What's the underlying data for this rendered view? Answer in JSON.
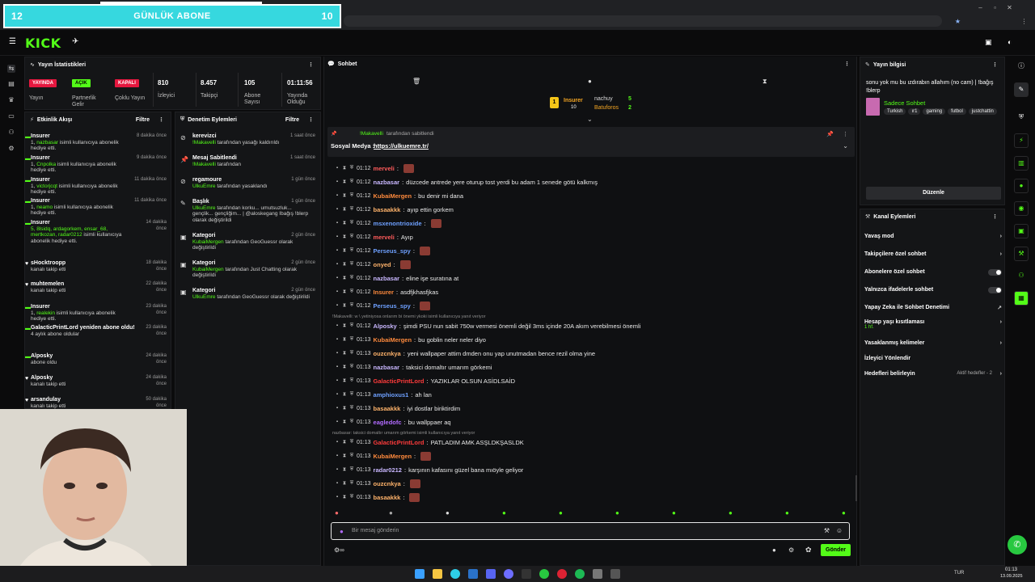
{
  "overlay": {
    "left_num": "12",
    "title": "GÜNLÜK ABONE",
    "right_num": "10"
  },
  "brand": {
    "logo": "KICK"
  },
  "stats": {
    "title": "Yayın İstatistikleri",
    "badges": [
      {
        "label": "YAYINDA",
        "color": "#e5173f",
        "caption": "Yayın"
      },
      {
        "label": "AÇIK",
        "color": "#53fc18",
        "caption": "Partnerlik Gelir"
      },
      {
        "label": "KAPALI",
        "color": "#e5173f",
        "caption": "Çoklu Yayın"
      }
    ],
    "numbers": [
      {
        "value": "810",
        "label": "İzleyici"
      },
      {
        "value": "8.457",
        "label": "Takipçi"
      },
      {
        "value": "105",
        "label": "Abone Sayısı"
      },
      {
        "value": "01:11:56",
        "label": "Yayında Olduğu"
      }
    ]
  },
  "activity": {
    "title": "Etkinlik Akışı",
    "filter": "Filtre",
    "items": [
      {
        "name": "Insurer",
        "desc_pre": "1, ",
        "desc_hl": "nazbasar",
        "desc_post": " isimli kullanıcıya abonelik hediye etti.",
        "time": "8 dakika önce"
      },
      {
        "name": "Insurer",
        "desc_pre": "1, ",
        "desc_hl": "Cnpolka",
        "desc_post": " isimli kullanıcıya abonelik hediye etti.",
        "time": "9 dakika önce"
      },
      {
        "name": "Insurer",
        "desc_pre": "1, ",
        "desc_hl": "victorjcqt",
        "desc_post": " isimli kullanıcıya abonelik hediye etti.",
        "time": "11 dakika önce"
      },
      {
        "name": "Insurer",
        "desc_pre": "1, ",
        "desc_hl": "neamo",
        "desc_post": " isimli kullanıcıya abonelik hediye etti.",
        "time": "11 dakika önce"
      },
      {
        "name": "Insurer",
        "desc_pre": "",
        "desc_hl": "5, 8lsidq, ardagorkem, ensar_68, mertkozan, radar0212",
        "desc_post": " isimli kullanıcıya abonelik hediye etti.",
        "time": "14 dakika önce"
      },
      {
        "name": "sHocktroopp",
        "desc_pre": "kanalı takip etti",
        "desc_hl": "",
        "desc_post": "",
        "time": "18 dakika önce"
      },
      {
        "name": "muhtemelen",
        "desc_pre": "kanalı takip etti",
        "desc_hl": "",
        "desc_post": "",
        "time": "22 dakika önce"
      },
      {
        "name": "Insurer",
        "desc_pre": "1, ",
        "desc_hl": "realekin",
        "desc_post": " isimli kullanıcıya abonelik hediye etti.",
        "time": "23 dakika önce"
      },
      {
        "name": "GalacticPrintLord yeniden abone oldu!",
        "desc_pre": "4 aylık abone oldular",
        "desc_hl": "",
        "desc_post": "",
        "time": "23 dakika önce"
      },
      {
        "name": "Alposky",
        "desc_pre": "abone oldu",
        "desc_hl": "",
        "desc_post": "",
        "time": "24 dakika önce"
      },
      {
        "name": "Alposky",
        "desc_pre": "kanalı takip etti",
        "desc_hl": "",
        "desc_post": "",
        "time": "24 dakika önce"
      },
      {
        "name": "arsandulay",
        "desc_pre": "kanalı takip etti",
        "desc_hl": "",
        "desc_post": "",
        "time": "50 dakika önce"
      }
    ]
  },
  "moderation": {
    "title": "Denetim Eylemleri",
    "filter": "Filtre",
    "items": [
      {
        "name": "kerevizci",
        "hl": "!Makavelli",
        "post": " tarafından yasağı kaldırıldı",
        "time": "1 saat önce"
      },
      {
        "name": "Mesaj Sabitlendi",
        "hl": "!Makavelli",
        "post": " tarafından",
        "time": "1 saat önce"
      },
      {
        "name": "regamoure",
        "hl": "UlkuEmre",
        "post": " tarafından yasaklandı",
        "time": "1 gün önce"
      },
      {
        "name": "Başlık",
        "hl": "UlkuEmre",
        "post": " tarafından korku... umutsuzluk... gençlik... gençliğim... | @aloskegang Ibağış !blerp olarak değiştirildi",
        "time": "1 gün önce"
      },
      {
        "name": "Kategori",
        "hl": "KubaiMergen",
        "post": " tarafından GeoGuessr olarak değiştirildi",
        "time": "2 gün önce"
      },
      {
        "name": "Kategori",
        "hl": "KubaiMergen",
        "post": " tarafından Just Chatting olarak değiştirildi",
        "time": "2 gün önce"
      },
      {
        "name": "Kategori",
        "hl": "UlkuEmre",
        "post": " tarafından GeoGuessr olarak değiştirildi",
        "time": "2 gün önce"
      }
    ]
  },
  "chat": {
    "title": "Sohbet",
    "leaders": [
      {
        "rank": "1",
        "name": "Insurer",
        "count": "10",
        "color": "#f5a623"
      },
      {
        "rank": "",
        "name": "nachuy",
        "count": "5",
        "color": "#dcdcdc"
      },
      {
        "rank": "",
        "name": "Batuforos",
        "count": "2",
        "color": "#f5a623"
      }
    ],
    "pinned": {
      "by": "!Makavelli",
      "by_post": " tarafından sabitlendi",
      "text": "Sosyal Medya : ",
      "link": "https://ulkuemre.tr/"
    },
    "messages": [
      {
        "time": "01:12",
        "user": "merveli",
        "color": "#ff5b5b",
        "text": "",
        "emote": true
      },
      {
        "time": "01:12",
        "user": "nazbasar",
        "color": "#c9b7ff",
        "text": "düzcede antrede yere oturup tost yerdi bu adam 1 senede götü kalkmış",
        "emote": false
      },
      {
        "time": "01:12",
        "user": "KubaiMergen",
        "color": "#ff8a3d",
        "text": "bu denir mi dana",
        "emote": false
      },
      {
        "time": "01:12",
        "user": "basaakkk",
        "color": "#ffb36b",
        "text": "ayıp ettin gorkem",
        "emote": false
      },
      {
        "time": "01:12",
        "user": "msxenontrioxide",
        "color": "#6ea0ff",
        "text": "",
        "emote": true
      },
      {
        "time": "01:12",
        "user": "merveli",
        "color": "#ff5b5b",
        "text": "Ayıp",
        "emote": false
      },
      {
        "time": "01:12",
        "user": "Perseus_spy",
        "color": "#6ea0ff",
        "text": "",
        "emote": true
      },
      {
        "time": "01:12",
        "user": "onyed",
        "color": "#ffb36b",
        "text": "",
        "emote": true
      },
      {
        "time": "01:12",
        "user": "nazbasar",
        "color": "#c9b7ff",
        "text": "eline işe suratına at",
        "emote": false
      },
      {
        "time": "01:12",
        "user": "Insurer",
        "color": "#ff8a3d",
        "text": "asdfjkhasfjkas",
        "emote": false
      },
      {
        "time": "01:12",
        "user": "Perseus_spy",
        "color": "#6ea0ff",
        "text": "",
        "emote": true
      },
      {
        "time": "01:12",
        "user": "Alposky",
        "color": "#c9b7ff",
        "text": "şimdi PSU nun sabit 750w vermesi önemli değil 3ms içinde 20A akım verebilmesi önemli",
        "emote": false
      },
      {
        "time": "01:13",
        "user": "KubaiMergen",
        "color": "#ff8a3d",
        "text": "bu goblin neler neler diyo",
        "emote": false
      },
      {
        "time": "01:13",
        "user": "ouzcnkya",
        "color": "#ffb36b",
        "text": "yeni wallpaper attim dmden onu yap unutmadan bence rezil olma yine",
        "emote": false
      },
      {
        "time": "01:13",
        "user": "nazbasar",
        "color": "#c9b7ff",
        "text": "taksici domaltır umarım görkemi",
        "emote": false
      },
      {
        "time": "01:13",
        "user": "GalacticPrintLord",
        "color": "#ff3b3b",
        "text": "YAZIKLAR OLSUN ASİDLSAİD",
        "emote": false
      },
      {
        "time": "01:13",
        "user": "amphioxus1",
        "color": "#6ea0ff",
        "text": "ah lan",
        "emote": false
      },
      {
        "time": "01:13",
        "user": "basaakkk",
        "color": "#ffb36b",
        "text": "iyi dostlar biriktirdim",
        "emote": false
      },
      {
        "time": "01:13",
        "user": "eagledofc",
        "color": "#b26bff",
        "text": "bu wallppaer aq",
        "emote": false
      },
      {
        "time": "01:13",
        "user": "GalacticPrintLord",
        "color": "#ff3b3b",
        "text": "PATLADIM AMK ASŞLDKŞASLDK",
        "emote": false
      },
      {
        "time": "01:13",
        "user": "KubaiMergen",
        "color": "#ff8a3d",
        "text": "",
        "emote": true
      },
      {
        "time": "01:13",
        "user": "radar0212",
        "color": "#c9b7ff",
        "text": "karşının kafasını güzel bana mıöyle geliyor",
        "emote": false
      },
      {
        "time": "01:13",
        "user": "ouzcnkya",
        "color": "#ffb36b",
        "text": "",
        "emote": true
      },
      {
        "time": "01:13",
        "user": "basaakkk",
        "color": "#ffb36b",
        "text": "",
        "emote": true
      }
    ],
    "replies": [
      {
        "text": "!Makavelli: w \\ yetiniyosa onlarım bi önemi ykoki isimli kullanıcıya yanıt veriyor"
      },
      {
        "text": "nazbasar: taksici domaltır umarım görkemi isimli kullanıcıya yanıt veriyor"
      }
    ],
    "input_placeholder": "Bir mesaj gönderin",
    "send_label": "Gönder"
  },
  "info": {
    "title": "Yayın bilgisi",
    "stream_title": "sonu yok mu bu ızdırabın allahım (no cam) | !bağış !blerp",
    "category": "Sadece Sohbet",
    "tags": [
      "Turkish",
      "ır1",
      "gaming",
      "futbol",
      "justchattin"
    ],
    "edit_label": "Düzenle"
  },
  "channel": {
    "title": "Kanal Eylemleri",
    "rows": [
      {
        "label": "Yavaş mod",
        "type": "arrow",
        "sub": ""
      },
      {
        "label": "Takipçilere özel sohbet",
        "type": "arrow",
        "sub": ""
      },
      {
        "label": "Abonelere özel sohbet",
        "type": "toggle",
        "sub": ""
      },
      {
        "label": "Yalnızca ifadelerle sohbet",
        "type": "toggle",
        "sub": ""
      },
      {
        "label": "Yapay Zeka ile Sohbet Denetimi",
        "type": "ext",
        "sub": ""
      },
      {
        "label": "Hesap yaşı kısıtlaması",
        "type": "arrow",
        "sub": "1 hf."
      },
      {
        "label": "Yasaklanmış kelimeler",
        "type": "arrow",
        "sub": ""
      },
      {
        "label": "İzleyici Yönlendir",
        "type": "none",
        "sub": ""
      },
      {
        "label": "Hedefleri belirleyin",
        "type": "goal",
        "sub": "Aktif hedefler - 2"
      }
    ]
  },
  "taskbar": {
    "lang": "TUR",
    "time": "01:13",
    "date": "13.09.2025"
  }
}
